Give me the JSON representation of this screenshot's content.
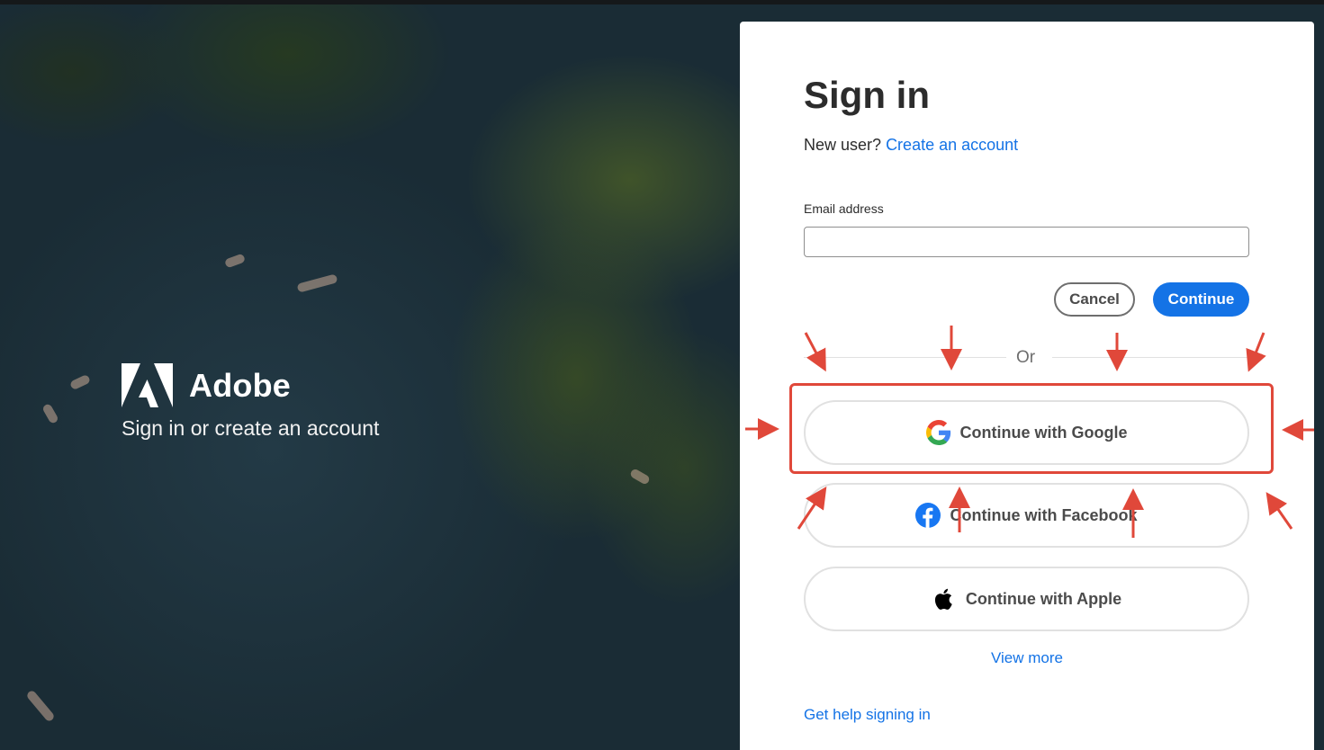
{
  "brand": {
    "name": "Adobe",
    "tagline": "Sign in or create an account"
  },
  "signin": {
    "title": "Sign in",
    "new_user_prompt": "New user?",
    "create_account_link": "Create an account",
    "email_label": "Email address",
    "email_value": "",
    "cancel_label": "Cancel",
    "continue_label": "Continue",
    "or_label": "Or",
    "social": [
      {
        "label": "Continue with Google",
        "icon": "google-icon"
      },
      {
        "label": "Continue with Facebook",
        "icon": "facebook-icon"
      },
      {
        "label": "Continue with Apple",
        "icon": "apple-icon"
      }
    ],
    "view_more": "View more",
    "help_link": "Get help signing in"
  },
  "colors": {
    "accent": "#1473e6",
    "annotation": "#e0483a",
    "facebook": "#1877f2"
  }
}
